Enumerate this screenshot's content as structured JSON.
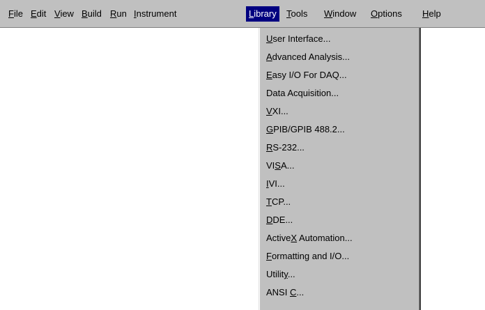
{
  "menubar": {
    "items": [
      {
        "label": "File",
        "mnemonic": "F"
      },
      {
        "label": "Edit",
        "mnemonic": "E"
      },
      {
        "label": "View",
        "mnemonic": "V"
      },
      {
        "label": "Build",
        "mnemonic": "B"
      },
      {
        "label": "Run",
        "mnemonic": "R"
      },
      {
        "label": "Instrument",
        "mnemonic": "I"
      },
      {
        "label": "Library",
        "mnemonic": "L"
      },
      {
        "label": "Tools",
        "mnemonic": "T"
      },
      {
        "label": "Window",
        "mnemonic": "W"
      },
      {
        "label": "Options",
        "mnemonic": "O"
      },
      {
        "label": "Help",
        "mnemonic": "H"
      }
    ],
    "active": "Library"
  },
  "library_menu": {
    "items": [
      {
        "label": "User Interface...",
        "mnemonic": "U"
      },
      {
        "label": "Advanced Analysis...",
        "mnemonic": "A"
      },
      {
        "label": "Easy I/O For DAQ...",
        "mnemonic": "E"
      },
      {
        "label": "Data Acquisition...",
        "mnemonic": ""
      },
      {
        "label": "VXI...",
        "mnemonic": "V"
      },
      {
        "label": "GPIB/GPIB 488.2...",
        "mnemonic": "G"
      },
      {
        "label": "RS-232...",
        "mnemonic": "R"
      },
      {
        "label": "VISA...",
        "mnemonic": "S"
      },
      {
        "label": "IVI...",
        "mnemonic": "I"
      },
      {
        "label": "TCP...",
        "mnemonic": "T"
      },
      {
        "label": "DDE...",
        "mnemonic": "D"
      },
      {
        "label": "ActiveX Automation...",
        "mnemonic": "X"
      },
      {
        "label": "Formatting and I/O...",
        "mnemonic": "F"
      },
      {
        "label": "Utility...",
        "mnemonic": "y"
      },
      {
        "label": "ANSI C...",
        "mnemonic": "C"
      }
    ]
  },
  "colors": {
    "menu_background": "#c0c0c0",
    "highlight": "#000080",
    "highlight_text": "#ffffff"
  }
}
